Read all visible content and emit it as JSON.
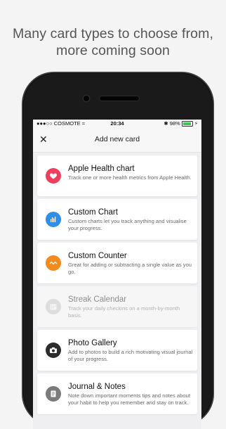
{
  "headline": {
    "line1": "Many card types to choose from,",
    "line2": "more coming soon"
  },
  "status_bar": {
    "carrier": "●●●○○ COSMOTE",
    "time": "20:34",
    "battery": "98%",
    "battery_level": 0.98
  },
  "nav": {
    "close_label": "✕",
    "title": "Add new card"
  },
  "cards": [
    {
      "title": "Apple Health chart",
      "desc": "Track one or more health metrics from Apple Health.",
      "color": "#ef3f5f",
      "icon": "heart-icon"
    },
    {
      "title": "Custom Chart",
      "desc": "Custom charts let you track anything and visualise your progress.",
      "color": "#2f8fe8",
      "icon": "bar-chart-icon"
    },
    {
      "title": "Custom Counter",
      "desc": "Great for adding or subtracting a single value as you go.",
      "color": "#f28a1c",
      "icon": "counter-wave-icon"
    },
    {
      "title": "Streak Calendar",
      "desc": "Track your daily checkins on a month-by-month basis.",
      "color": "#c9c9c9",
      "icon": "calendar-icon"
    },
    {
      "title": "Photo Gallery",
      "desc": "Add to photos to build a rich motivating visual journal of your progress.",
      "color": "#2c2c2c",
      "icon": "camera-icon"
    },
    {
      "title": "Journal & Notes",
      "desc": "Note down important moments tips and notes about your habit to help you remember and stay on track.",
      "color": "#7a7a7a",
      "icon": "notes-icon"
    }
  ]
}
